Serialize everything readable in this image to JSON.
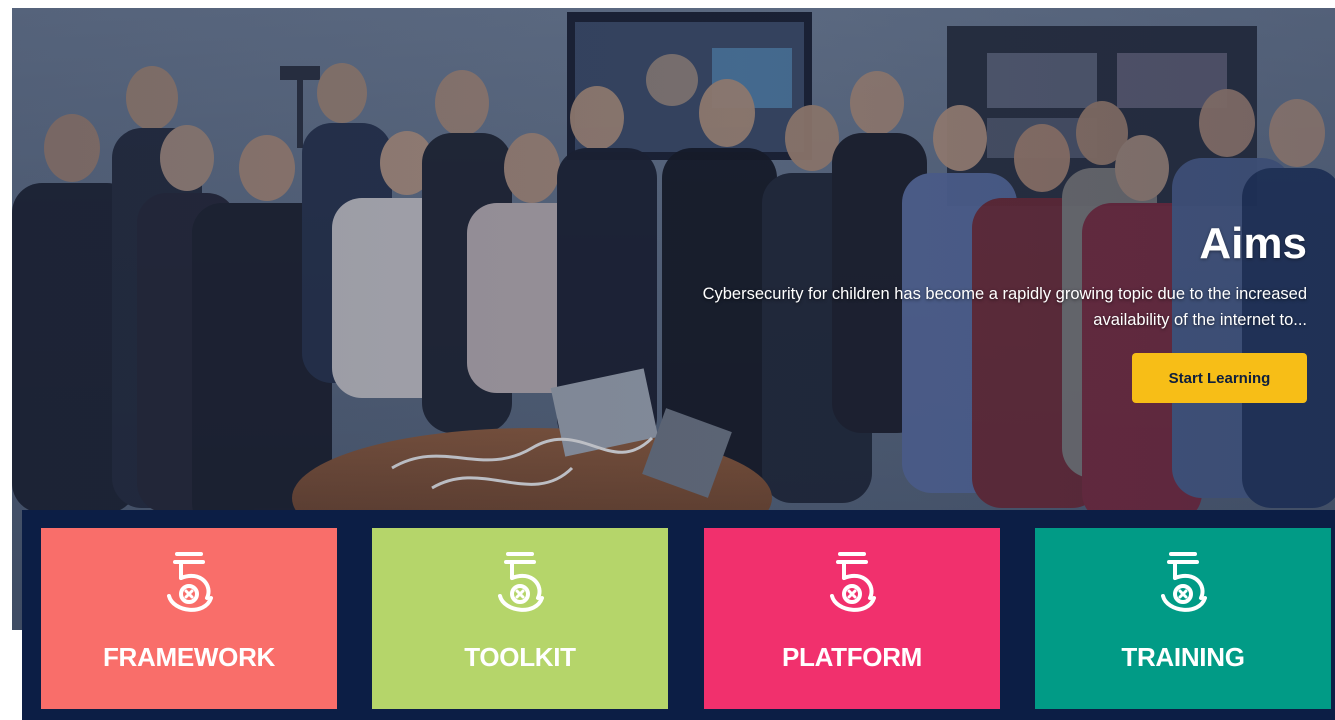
{
  "hero": {
    "title": "Aims",
    "text_line1": "Cybersecurity for children has become a rapidly growing topic due to the increased",
    "text_line2": "availability of the internet to...",
    "cta_label": "Start Learning"
  },
  "colors": {
    "navy": "#0c1e45",
    "accent_yellow": "#f7be17"
  },
  "cards": [
    {
      "label": "FRAMEWORK",
      "color": "#f96e6a",
      "icon": "cybersafe-5-logo-icon"
    },
    {
      "label": "TOOLKIT",
      "color": "#b5d56a",
      "icon": "cybersafe-5-logo-icon"
    },
    {
      "label": "PLATFORM",
      "color": "#f1306d",
      "icon": "cybersafe-5-logo-icon"
    },
    {
      "label": "TRAINING",
      "color": "#019b86",
      "icon": "cybersafe-5-logo-icon"
    }
  ]
}
